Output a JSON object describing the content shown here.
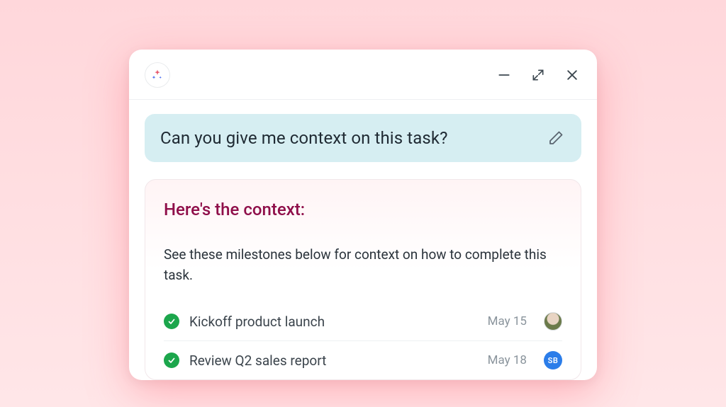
{
  "prompt": {
    "text": "Can you give me context on this task?"
  },
  "response": {
    "heading": "Here's the context:",
    "body": "See these milestones below for context on how to complete this task."
  },
  "milestones": [
    {
      "title": "Kickoff product launch",
      "date": "May 15",
      "assignee_kind": "photo",
      "assignee_initials": ""
    },
    {
      "title": "Review Q2 sales report",
      "date": "May 18",
      "assignee_kind": "initials",
      "assignee_initials": "SB"
    }
  ]
}
